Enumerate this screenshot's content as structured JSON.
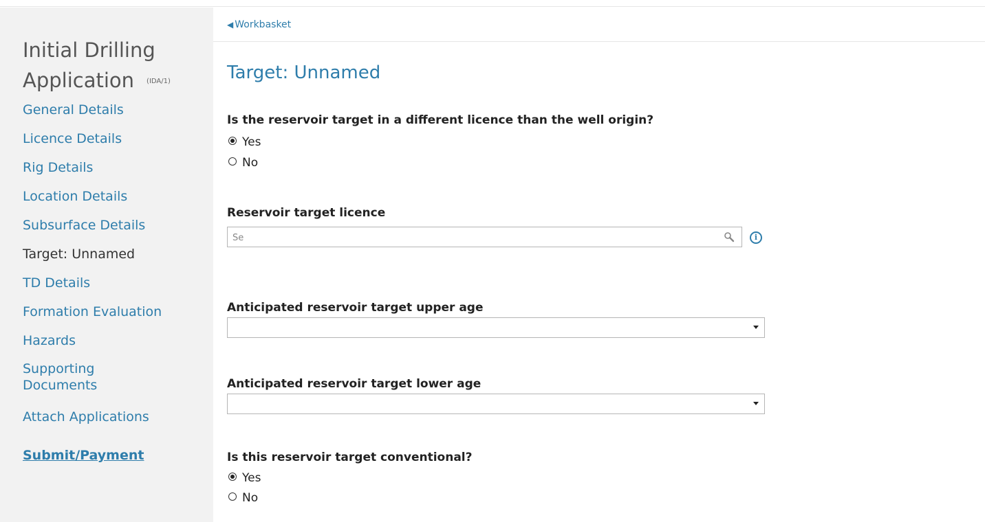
{
  "sidebar": {
    "app_title_line1": "Initial Drilling",
    "app_title_line2": "Application",
    "app_code": "(IDA/1)",
    "items": [
      {
        "label": "General Details"
      },
      {
        "label": "Licence Details"
      },
      {
        "label": "Rig Details"
      },
      {
        "label": "Location Details"
      },
      {
        "label": "Subsurface Details"
      },
      {
        "label": "Target: Unnamed"
      },
      {
        "label": "TD Details"
      },
      {
        "label": "Formation Evaluation"
      },
      {
        "label": "Hazards"
      },
      {
        "label": "Supporting"
      },
      {
        "label": "Documents"
      },
      {
        "label": "Attach Applications"
      },
      {
        "label": "Submit/Payment"
      }
    ]
  },
  "breadcrumb": {
    "back_label": "Workbasket"
  },
  "page": {
    "title": "Target: Unnamed",
    "q_different_licence": {
      "label": "Is the reservoir target in a different licence than the well origin?",
      "options": [
        "Yes",
        "No"
      ],
      "selected": "Yes"
    },
    "licence": {
      "label": "Reservoir target licence",
      "value": "",
      "placeholder": "Se"
    },
    "upper_age": {
      "label": "Anticipated reservoir target upper age",
      "value": ""
    },
    "lower_age": {
      "label": "Anticipated reservoir target lower age",
      "value": ""
    },
    "q_conventional": {
      "label": "Is this reservoir target conventional?",
      "options": [
        "Yes",
        "No"
      ],
      "selected": "Yes"
    }
  },
  "colors": {
    "link": "#2e7dab",
    "sidebar_bg": "#f2f2f2"
  },
  "icons": {
    "back": "triangle-left-icon",
    "search": "magnifier-icon",
    "info": "info-icon",
    "dropdown": "chevron-down-icon"
  }
}
